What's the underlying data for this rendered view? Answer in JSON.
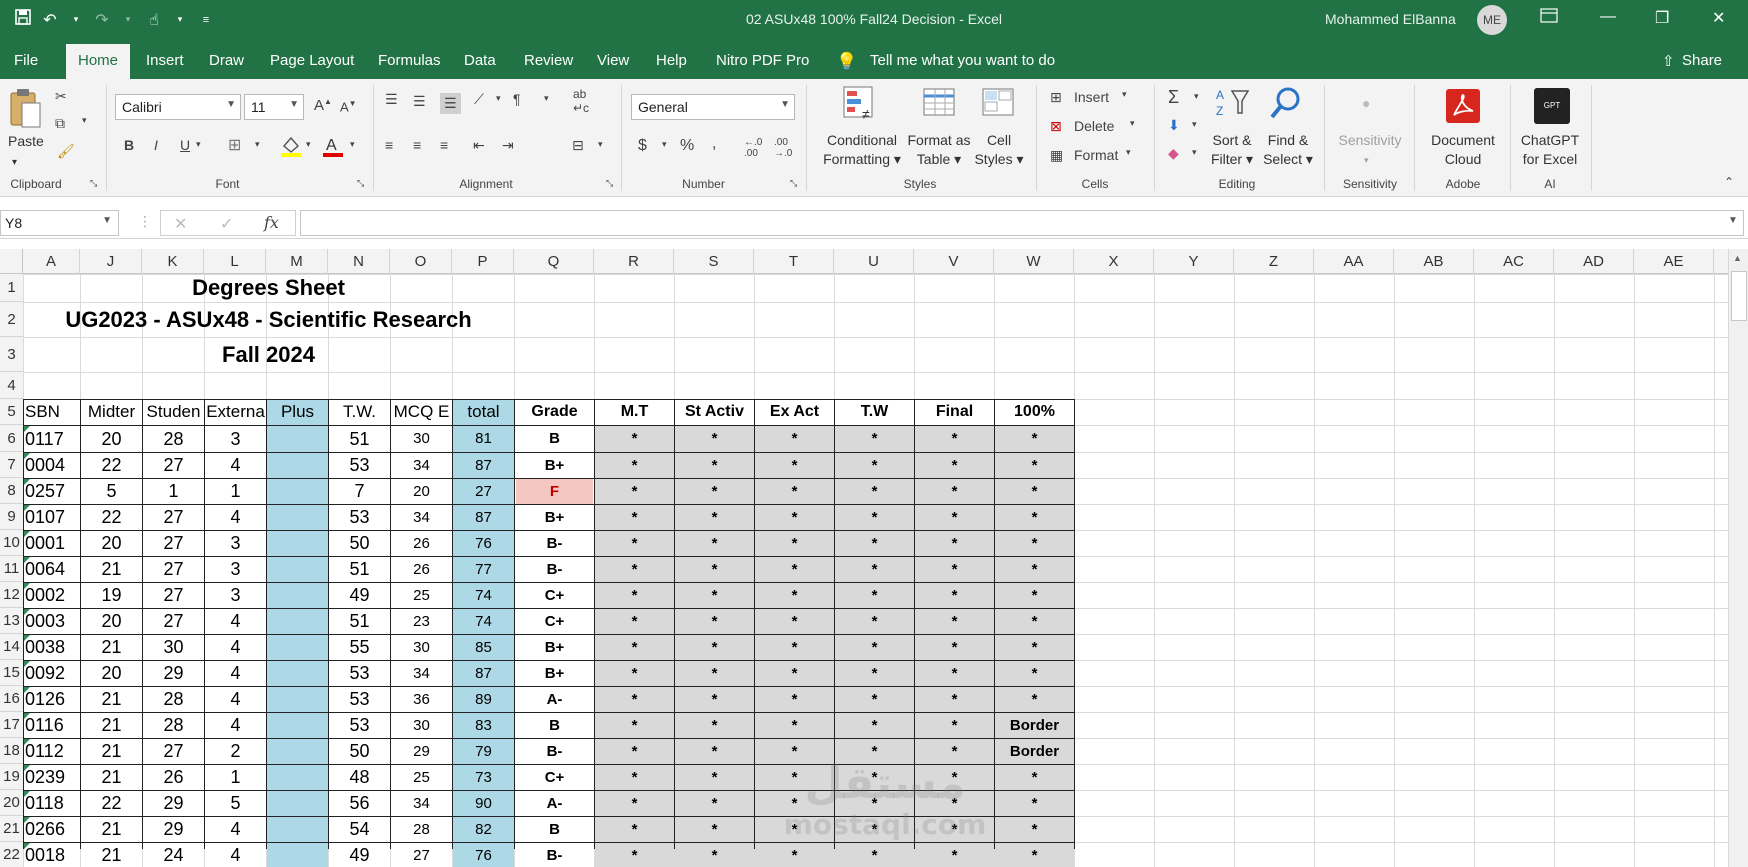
{
  "window": {
    "title": "02 ASUx48 100% Fall24  Decision  -  Excel",
    "user": "Mohammed ElBanna",
    "initials": "ME"
  },
  "tabs": [
    "File",
    "Home",
    "Insert",
    "Draw",
    "Page Layout",
    "Formulas",
    "Data",
    "Review",
    "View",
    "Help",
    "Nitro PDF Pro"
  ],
  "tell_me": "Tell me what you want to do",
  "share": "Share",
  "ribbon": {
    "paste": "Paste",
    "font_name": "Calibri",
    "font_size": "11",
    "number_format": "General",
    "conditional": [
      "Conditional",
      "Formatting"
    ],
    "format_table": [
      "Format as",
      "Table"
    ],
    "cell_styles": [
      "Cell",
      "Styles"
    ],
    "insert": "Insert",
    "delete": "Delete",
    "format": "Format",
    "sort": [
      "Sort &",
      "Filter"
    ],
    "find": [
      "Find &",
      "Select"
    ],
    "sensitivity": "Sensitivity",
    "doc_cloud": [
      "Document",
      "Cloud"
    ],
    "chatgpt": [
      "ChatGPT",
      "for Excel"
    ],
    "gpt_logo": "GPT",
    "groups": [
      "Clipboard",
      "Font",
      "Alignment",
      "Number",
      "Styles",
      "Cells",
      "Editing",
      "Sensitivity",
      "Adobe",
      "AI"
    ]
  },
  "formula_bar": {
    "name_box": "Y8",
    "formula": ""
  },
  "columns": [
    "A",
    "J",
    "K",
    "L",
    "M",
    "N",
    "O",
    "P",
    "Q",
    "R",
    "S",
    "T",
    "U",
    "V",
    "W",
    "X",
    "Y",
    "Z",
    "AA",
    "AB",
    "AC",
    "AD",
    "AE"
  ],
  "sheet": {
    "title1": "Degrees Sheet",
    "title2": "UG2023 - ASUx48 - Scientific Research",
    "title3": "Fall 2024",
    "headers": [
      "SBN",
      "Midter",
      "Studen",
      "Externa",
      "Plus",
      "T.W.",
      "MCQ E",
      "total",
      "Grade",
      "M.T",
      "St Activ",
      "Ex Act",
      "T.W",
      "Final",
      "100%"
    ],
    "rows": [
      [
        "0117",
        "20",
        "28",
        "3",
        "",
        "51",
        "30",
        "81",
        "B",
        "*",
        "*",
        "*",
        "*",
        "*",
        "*"
      ],
      [
        "0004",
        "22",
        "27",
        "4",
        "",
        "53",
        "34",
        "87",
        "B+",
        "*",
        "*",
        "*",
        "*",
        "*",
        "*"
      ],
      [
        "0257",
        "5",
        "1",
        "1",
        "",
        "7",
        "20",
        "27",
        "F",
        "*",
        "*",
        "*",
        "*",
        "*",
        "*"
      ],
      [
        "0107",
        "22",
        "27",
        "4",
        "",
        "53",
        "34",
        "87",
        "B+",
        "*",
        "*",
        "*",
        "*",
        "*",
        "*"
      ],
      [
        "0001",
        "20",
        "27",
        "3",
        "",
        "50",
        "26",
        "76",
        "B-",
        "*",
        "*",
        "*",
        "*",
        "*",
        "*"
      ],
      [
        "0064",
        "21",
        "27",
        "3",
        "",
        "51",
        "26",
        "77",
        "B-",
        "*",
        "*",
        "*",
        "*",
        "*",
        "*"
      ],
      [
        "0002",
        "19",
        "27",
        "3",
        "",
        "49",
        "25",
        "74",
        "C+",
        "*",
        "*",
        "*",
        "*",
        "*",
        "*"
      ],
      [
        "0003",
        "20",
        "27",
        "4",
        "",
        "51",
        "23",
        "74",
        "C+",
        "*",
        "*",
        "*",
        "*",
        "*",
        "*"
      ],
      [
        "0038",
        "21",
        "30",
        "4",
        "",
        "55",
        "30",
        "85",
        "B+",
        "*",
        "*",
        "*",
        "*",
        "*",
        "*"
      ],
      [
        "0092",
        "20",
        "29",
        "4",
        "",
        "53",
        "34",
        "87",
        "B+",
        "*",
        "*",
        "*",
        "*",
        "*",
        "*"
      ],
      [
        "0126",
        "21",
        "28",
        "4",
        "",
        "53",
        "36",
        "89",
        "A-",
        "*",
        "*",
        "*",
        "*",
        "*",
        "*"
      ],
      [
        "0116",
        "21",
        "28",
        "4",
        "",
        "53",
        "30",
        "83",
        "B",
        "*",
        "*",
        "*",
        "*",
        "*",
        "Border"
      ],
      [
        "0112",
        "21",
        "27",
        "2",
        "",
        "50",
        "29",
        "79",
        "B-",
        "*",
        "*",
        "*",
        "*",
        "*",
        "Border"
      ],
      [
        "0239",
        "21",
        "26",
        "1",
        "",
        "48",
        "25",
        "73",
        "C+",
        "*",
        "*",
        "*",
        "*",
        "*",
        "*"
      ],
      [
        "0118",
        "22",
        "29",
        "5",
        "",
        "56",
        "34",
        "90",
        "A-",
        "*",
        "*",
        "*",
        "*",
        "*",
        "*"
      ],
      [
        "0266",
        "21",
        "29",
        "4",
        "",
        "54",
        "28",
        "82",
        "B",
        "*",
        "*",
        "*",
        "*",
        "*",
        "*"
      ],
      [
        "0018",
        "21",
        "24",
        "4",
        "",
        "49",
        "27",
        "76",
        "B-",
        "*",
        "*",
        "*",
        "*",
        "*",
        "*"
      ]
    ]
  },
  "watermark": [
    "مستقل",
    "mostaql.com"
  ],
  "colors": {
    "excel_green": "#217346",
    "plus_fill": "#add8e6",
    "total_fill": "#add8e6",
    "grade_fill": "#add8e6",
    "fail_fill": "#f4c7c3",
    "fail_text": "#c00000",
    "calc_fill": "#d9d9d9"
  }
}
